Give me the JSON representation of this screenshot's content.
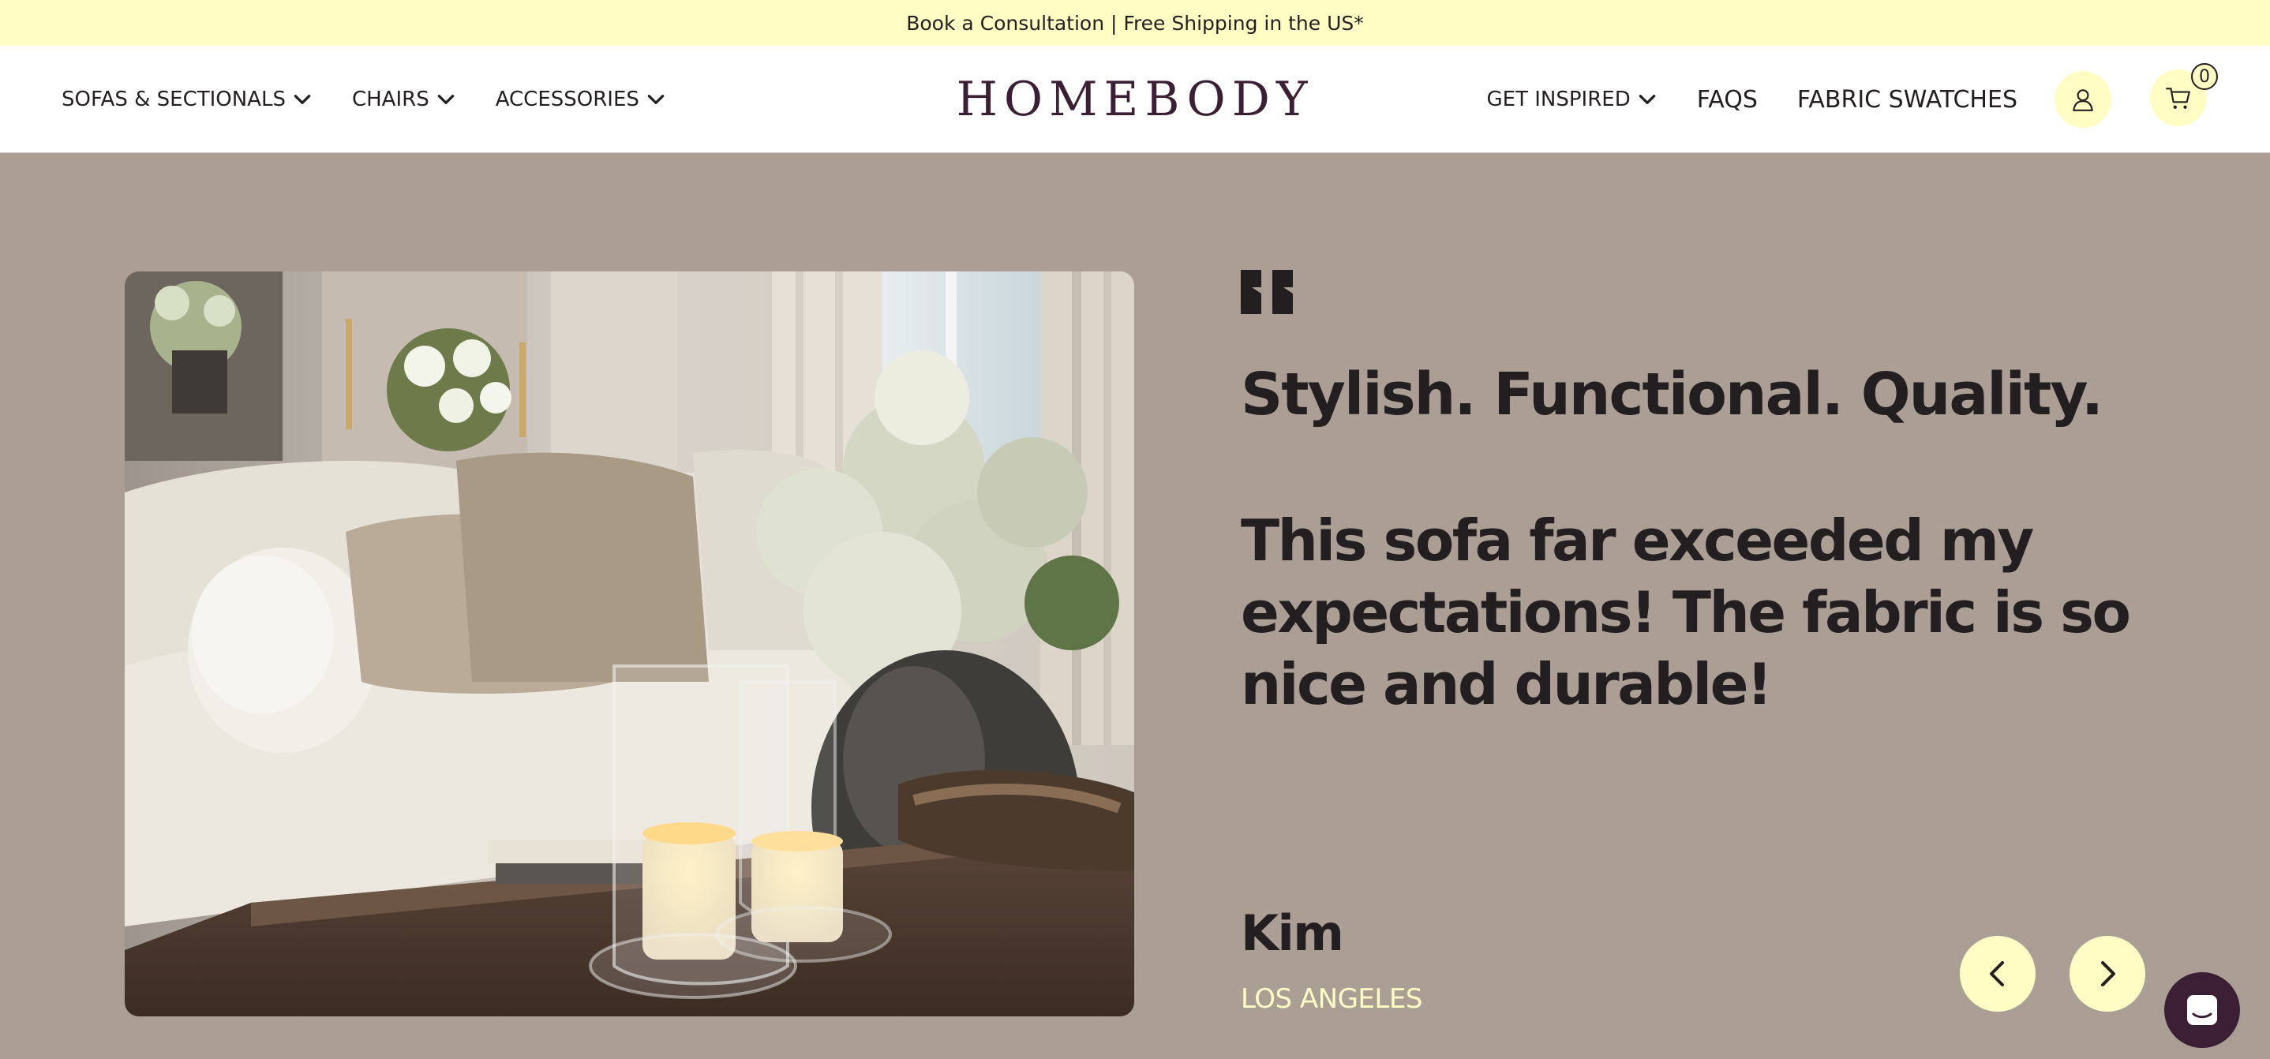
{
  "announcement": {
    "text": "Book a Consultation | Free Shipping in the US*"
  },
  "header": {
    "nav_left": [
      {
        "label": "SOFAS & SECTIONALS",
        "icon": "chevron-down-icon"
      },
      {
        "label": "CHAIRS",
        "icon": "chevron-down-icon"
      },
      {
        "label": "ACCESSORIES",
        "icon": "chevron-down-icon"
      }
    ],
    "logo": "HOMEBODY",
    "nav_right": [
      {
        "label": "GET INSPIRED",
        "icon": "chevron-down-icon"
      },
      {
        "label": "FAQS"
      },
      {
        "label": "FABRIC SWATCHES"
      }
    ],
    "account_icon": "user-icon",
    "cart_icon": "cart-icon",
    "cart_count": "0"
  },
  "testimonial": {
    "image_description_icon": "living-room-photo",
    "quote_icon": "quote-icon",
    "title": "Stylish. Functional. Quality.",
    "body": "This sofa far exceeded my expectations! The fabric is so nice and durable!",
    "author_name": "Kim",
    "author_location": "LOS ANGELES",
    "prev_icon": "chevron-left-icon",
    "next_icon": "chevron-right-icon"
  },
  "chat": {
    "icon": "chat-icon"
  },
  "colors": {
    "announcement_bg": "#fffcc4",
    "section_bg": "#ab9f95",
    "brand": "#3a1f35",
    "text": "#231f20",
    "accent": "#fffcc4"
  }
}
